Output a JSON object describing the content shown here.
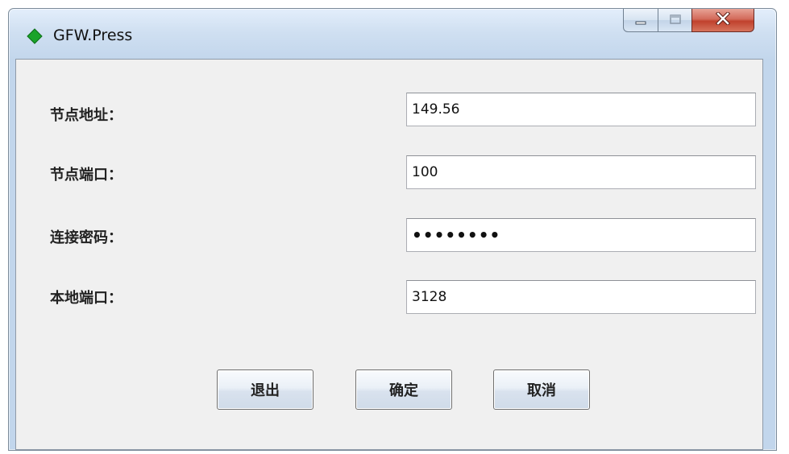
{
  "window": {
    "title": "GFW.Press",
    "icon": "green-diamond-icon",
    "controls": {
      "minimize": "minimize-icon",
      "maximize": "maximize-icon",
      "close": "close-icon"
    }
  },
  "form": {
    "fields": [
      {
        "label": "节点地址：",
        "value": "149.56"
      },
      {
        "label": "节点端口：",
        "value": "100"
      },
      {
        "label": "连接密码：",
        "value": "••••••••"
      },
      {
        "label": "本地端口：",
        "value": "3128"
      }
    ]
  },
  "buttons": {
    "exit_label": "退出",
    "ok_label": "确定",
    "cancel_label": "取消"
  },
  "colors": {
    "accent_close": "#c0412d",
    "app_icon": "#1aa32a"
  }
}
